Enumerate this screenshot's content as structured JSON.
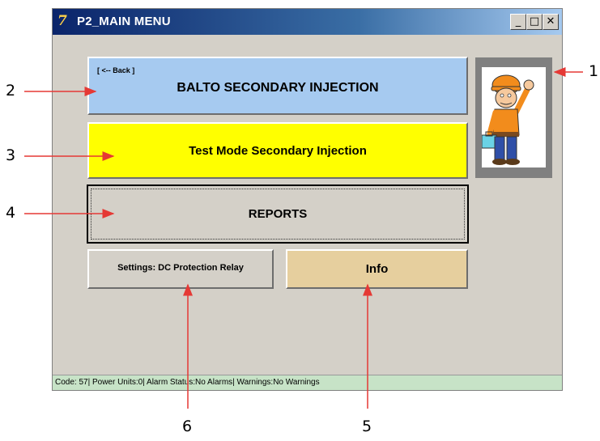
{
  "window": {
    "title": "P2_MAIN MENU",
    "icon": "7f-app-icon",
    "controls": {
      "minimize": "_",
      "maximize": "□",
      "close": "✕"
    }
  },
  "buttons": {
    "balto": {
      "back_label": "[ <-- Back ]",
      "title": "BALTO SECONDARY INJECTION"
    },
    "test_mode": "Test Mode Secondary Injection",
    "reports": "REPORTS",
    "settings": "Settings: DC Protection Relay",
    "info": "Info"
  },
  "status_bar": "Code: 57| Power Units:0| Alarm Status:No Alarms| Warnings:No Warnings",
  "figure": {
    "icon": "technician-with-toolbox-icon"
  },
  "callouts": [
    "1",
    "2",
    "3",
    "4",
    "5",
    "6"
  ],
  "colors": {
    "balto_button": "#a6caf0",
    "test_mode_button": "#ffff00",
    "info_button": "#e6cf9e",
    "status_bar": "#c7e3c7",
    "callout_arrow": "#e53935"
  }
}
